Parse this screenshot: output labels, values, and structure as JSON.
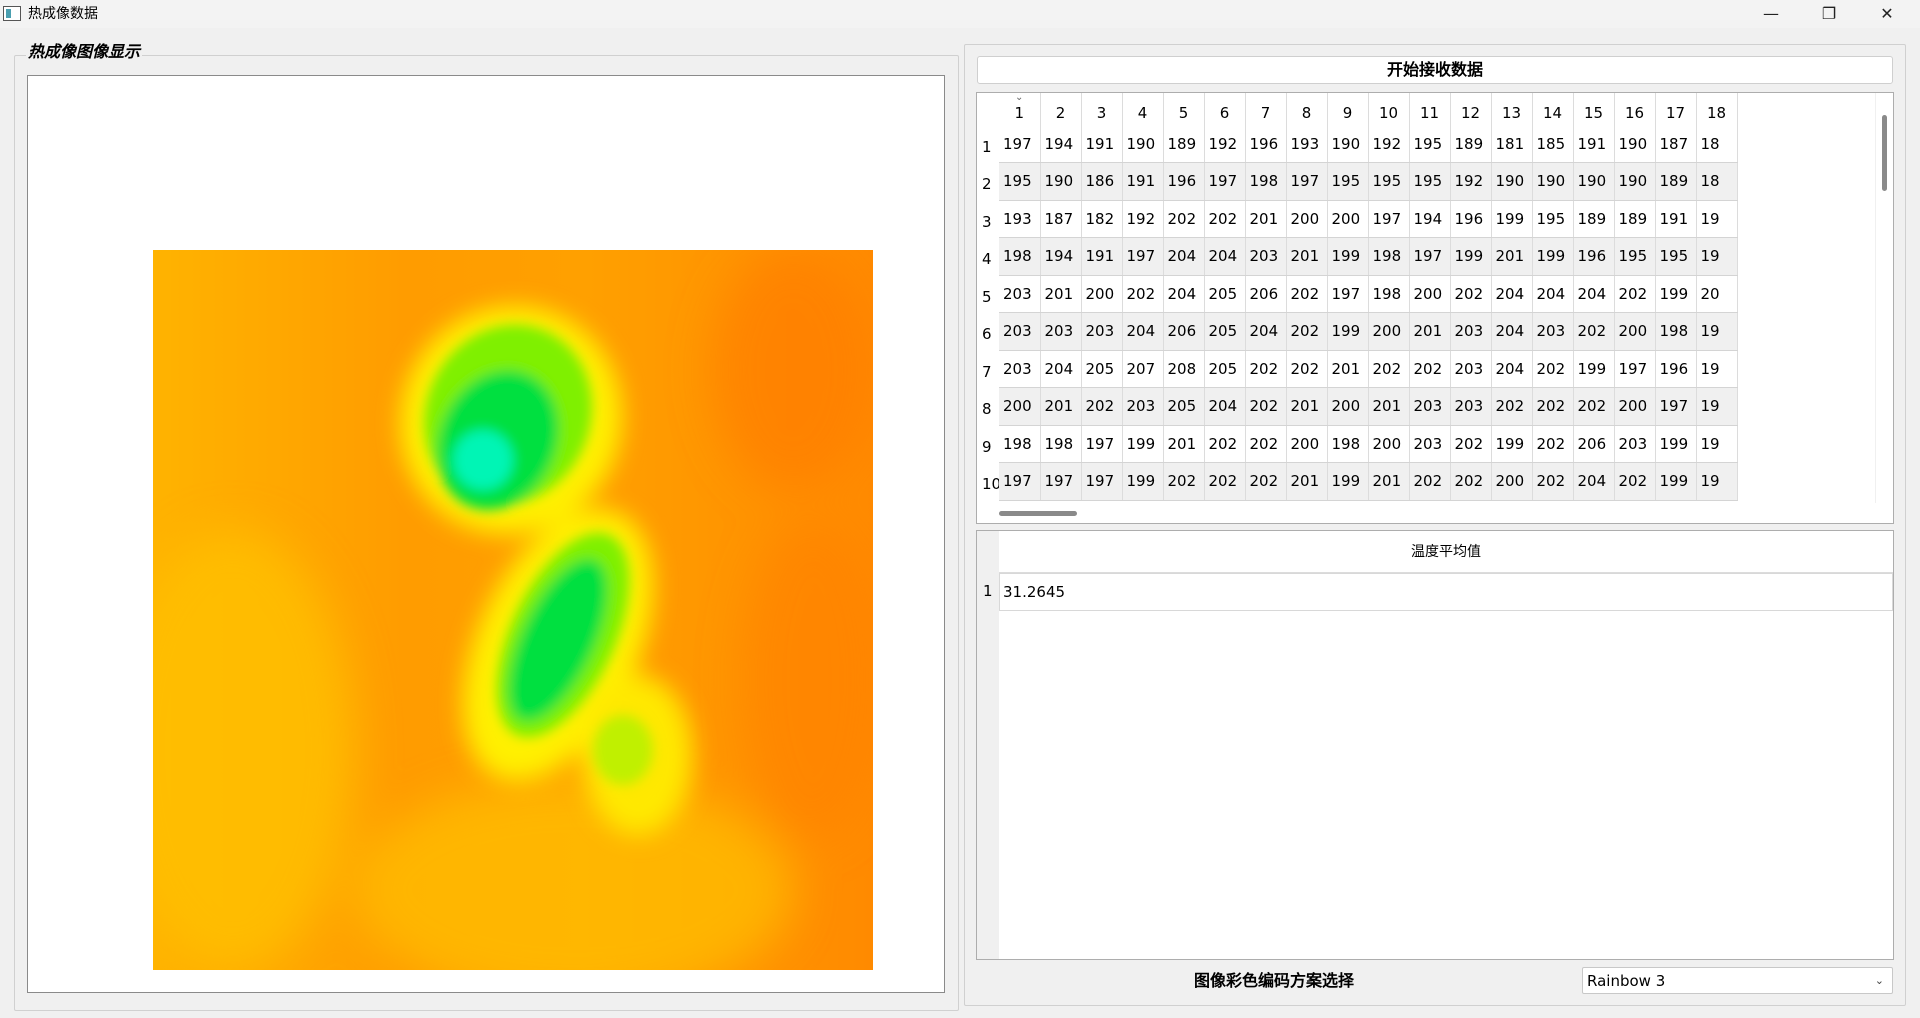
{
  "window": {
    "title": "热成像数据",
    "controls": {
      "minimize": "—",
      "restore": "❐",
      "close": "✕"
    }
  },
  "left_panel": {
    "group_title": "热成像图像显示",
    "colormap_stops": [
      "#00f5b5",
      "#00e040",
      "#7ff000",
      "#fff000",
      "#ffc000",
      "#ff8a00"
    ]
  },
  "right_panel": {
    "start_button_label": "开始接收数据",
    "data_table": {
      "columns": [
        "1",
        "2",
        "3",
        "4",
        "5",
        "6",
        "7",
        "8",
        "9",
        "10",
        "11",
        "12",
        "13",
        "14",
        "15",
        "16",
        "17",
        "18"
      ],
      "row_headers": [
        "1",
        "2",
        "3",
        "4",
        "5",
        "6",
        "7",
        "8",
        "9",
        "10"
      ],
      "rows": [
        [
          "197",
          "194",
          "191",
          "190",
          "189",
          "192",
          "196",
          "193",
          "190",
          "192",
          "195",
          "189",
          "181",
          "185",
          "191",
          "190",
          "187",
          "18"
        ],
        [
          "195",
          "190",
          "186",
          "191",
          "196",
          "197",
          "198",
          "197",
          "195",
          "195",
          "195",
          "192",
          "190",
          "190",
          "190",
          "190",
          "189",
          "18"
        ],
        [
          "193",
          "187",
          "182",
          "192",
          "202",
          "202",
          "201",
          "200",
          "200",
          "197",
          "194",
          "196",
          "199",
          "195",
          "189",
          "189",
          "191",
          "19"
        ],
        [
          "198",
          "194",
          "191",
          "197",
          "204",
          "204",
          "203",
          "201",
          "199",
          "198",
          "197",
          "199",
          "201",
          "199",
          "196",
          "195",
          "195",
          "19"
        ],
        [
          "203",
          "201",
          "200",
          "202",
          "204",
          "205",
          "206",
          "202",
          "197",
          "198",
          "200",
          "202",
          "204",
          "204",
          "204",
          "202",
          "199",
          "20"
        ],
        [
          "203",
          "203",
          "203",
          "204",
          "206",
          "205",
          "204",
          "202",
          "199",
          "200",
          "201",
          "203",
          "204",
          "203",
          "202",
          "200",
          "198",
          "19"
        ],
        [
          "203",
          "204",
          "205",
          "207",
          "208",
          "205",
          "202",
          "202",
          "201",
          "202",
          "202",
          "203",
          "204",
          "202",
          "199",
          "197",
          "196",
          "19"
        ],
        [
          "200",
          "201",
          "202",
          "203",
          "205",
          "204",
          "202",
          "201",
          "200",
          "201",
          "203",
          "203",
          "202",
          "202",
          "202",
          "200",
          "197",
          "19"
        ],
        [
          "198",
          "198",
          "197",
          "199",
          "201",
          "202",
          "202",
          "200",
          "198",
          "200",
          "203",
          "202",
          "199",
          "202",
          "206",
          "203",
          "199",
          "19"
        ],
        [
          "197",
          "197",
          "197",
          "199",
          "202",
          "202",
          "202",
          "201",
          "199",
          "201",
          "202",
          "202",
          "200",
          "202",
          "204",
          "202",
          "199",
          "19"
        ]
      ]
    },
    "avg_table": {
      "header": "温度平均值",
      "row_header": "1",
      "value": "31.2645"
    },
    "color_scheme": {
      "label": "图像彩色编码方案选择",
      "selected": "Rainbow 3"
    }
  }
}
